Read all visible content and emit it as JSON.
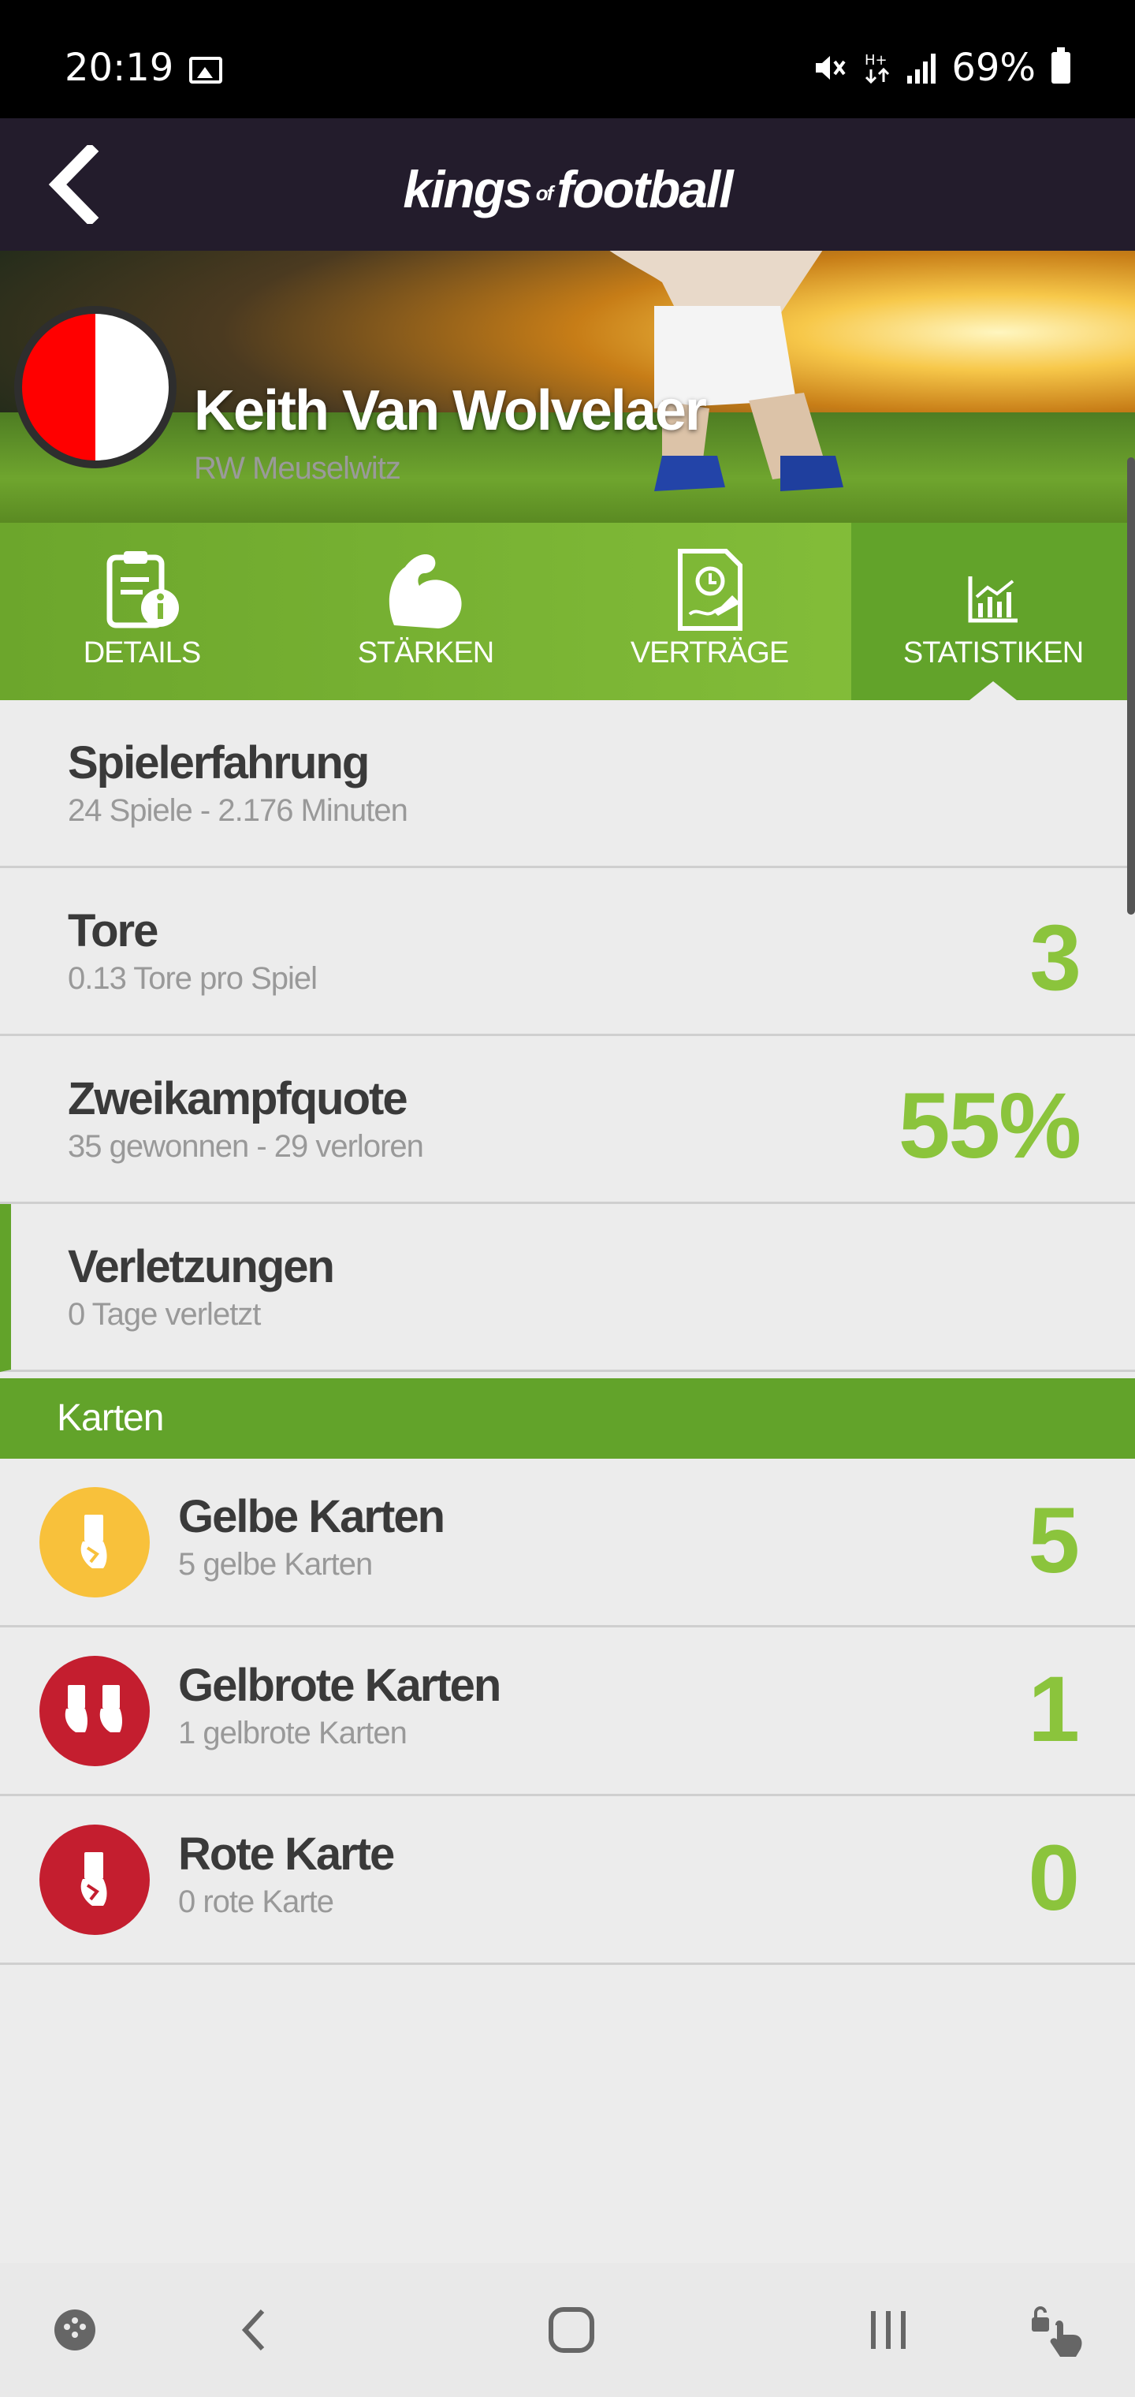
{
  "status_bar": {
    "time": "20:19",
    "battery": "69%",
    "icons": [
      "image-icon",
      "mute-icon",
      "data-icon",
      "signal-icon",
      "battery-icon"
    ]
  },
  "header": {
    "logo_main_1": "kings",
    "logo_of": "of",
    "logo_main_2": "football",
    "back_icon": "chevron-left-icon"
  },
  "player": {
    "name": "Keith Van Wolvelaer",
    "club": "RW Meuselwitz",
    "badge_colors": [
      "#ff0000",
      "#ffffff"
    ]
  },
  "tabs": [
    {
      "label": "DETAILS",
      "icon": "details-icon",
      "active": false
    },
    {
      "label": "STÄRKEN",
      "icon": "strength-icon",
      "active": false
    },
    {
      "label": "VERTRÄGE",
      "icon": "contract-icon",
      "active": false
    },
    {
      "label": "STATISTIKEN",
      "icon": "chart-icon",
      "active": true
    }
  ],
  "stats": [
    {
      "title": "Spielerfahrung",
      "sub": "24 Spiele - 2.176 Minuten",
      "value": ""
    },
    {
      "title": "Tore",
      "sub": "0.13 Tore pro Spiel",
      "value": "3"
    },
    {
      "title": "Zweikampfquote",
      "sub": "35 gewonnen - 29 verloren",
      "value": "55%"
    },
    {
      "title": "Verletzungen",
      "sub": "0 Tage verletzt",
      "value": ""
    }
  ],
  "cards_section": {
    "title": "Karten",
    "items": [
      {
        "title": "Gelbe Karten",
        "sub": "5 gelbe Karten",
        "value": "5",
        "color": "#f8c13b"
      },
      {
        "title": "Gelbrote Karten",
        "sub": "1 gelbrote Karten",
        "value": "1",
        "color": "#c41e2f"
      },
      {
        "title": "Rote Karte",
        "sub": "0 rote Karte",
        "value": "0",
        "color": "#c41e2f"
      }
    ]
  },
  "colors": {
    "accent_green": "#8bc43c",
    "tab_green": "#62a32a",
    "header_dark": "#231c2c"
  },
  "nav_bar": {
    "icons": [
      "game-launcher-icon",
      "back-icon",
      "home-icon",
      "recents-icon",
      "touch-lock-icon"
    ]
  }
}
